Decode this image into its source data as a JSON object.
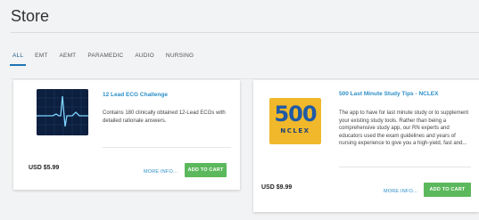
{
  "store": {
    "title": "Store"
  },
  "tabs": [
    {
      "label": "ALL",
      "active": true
    },
    {
      "label": "EMT",
      "active": false
    },
    {
      "label": "AEMT",
      "active": false
    },
    {
      "label": "PARAMEDIC",
      "active": false
    },
    {
      "label": "AUDIO",
      "active": false
    },
    {
      "label": "NURSING",
      "active": false
    }
  ],
  "products": [
    {
      "title": "12 Lead ECG Challenge",
      "description": "Contains 180 clinically obtained 12-Lead ECGs with detailed rationale answers.",
      "price": "USD $5.99",
      "more_label": "MORE INFO...",
      "cart_label": "ADD TO CART",
      "icon": "ecg-waveform-icon"
    },
    {
      "title": "500 Last Minute Study Tips - NCLEX",
      "description": "The app to have for last minute study or to supplement your existing study tools. Rather than being a comprehensive study app, our RN experts and educators used the exam guidelines and years of nursing experience to give you a high-yield, fast and...",
      "price": "USD $9.99",
      "more_label": "MORE INFO...",
      "cart_label": "ADD TO CART",
      "icon": "nclex-500-icon",
      "icon_text_number": "500",
      "icon_text_label": "NCLEX"
    }
  ],
  "colors": {
    "accent": "#1d74b4",
    "link": "#2b8fc7",
    "cart_button": "#5cb85c",
    "background": "#f2f3f4"
  }
}
